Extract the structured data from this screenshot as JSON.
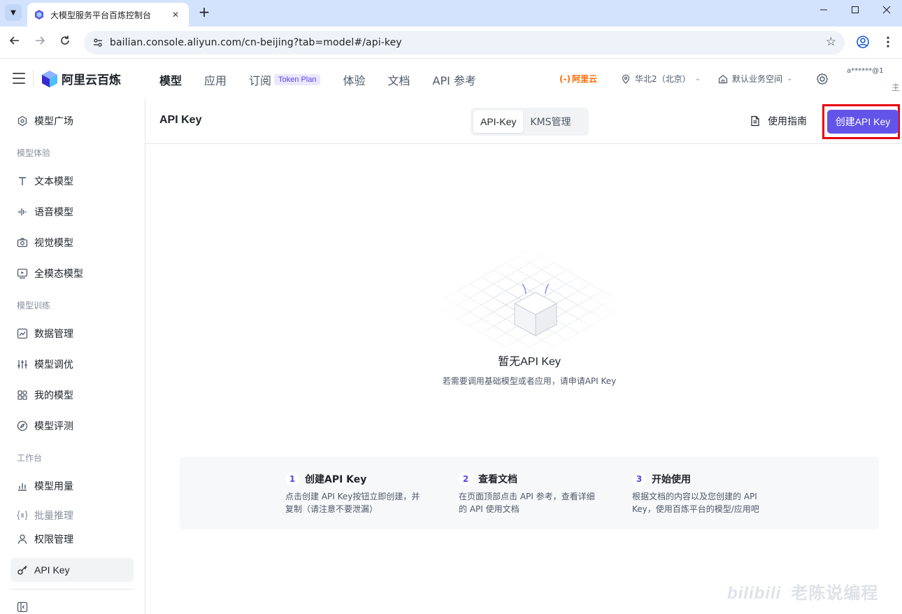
{
  "browser": {
    "tab_title": "大模型服务平台百炼控制台",
    "tab_close": "✕",
    "new_tab": "+",
    "url": "bailian.console.aliyun.com/cn-beijing?tab=model#/api-key"
  },
  "header": {
    "brand": "阿里云百炼",
    "nav": [
      {
        "label": "模型"
      },
      {
        "label": "应用"
      },
      {
        "label": "订阅"
      },
      {
        "label": "体验"
      },
      {
        "label": "文档"
      },
      {
        "label": "API 参考"
      }
    ],
    "token_badge": "Token Plan",
    "aliyun_mark": "(-)",
    "aliyun_label": "阿里云",
    "region": "华北2（北京）",
    "workspace": "默认业务空间",
    "user": "a******@1",
    "user_role": "主"
  },
  "sidebar": {
    "items": [
      {
        "label": "模型广场"
      },
      {
        "label": "文本模型"
      },
      {
        "label": "语音模型"
      },
      {
        "label": "视觉模型"
      },
      {
        "label": "全模态模型"
      },
      {
        "label": "数据管理"
      },
      {
        "label": "模型调优"
      },
      {
        "label": "我的模型"
      },
      {
        "label": "模型评测"
      },
      {
        "label": "模型用量"
      },
      {
        "label": "批量推理"
      },
      {
        "label": "权限管理"
      },
      {
        "label": "API Key"
      }
    ],
    "groups": [
      "模型体验",
      "模型训练",
      "工作台"
    ]
  },
  "page": {
    "title": "API Key",
    "tabs": [
      {
        "label": "API-Key"
      },
      {
        "label": "KMS管理"
      }
    ],
    "guide_label": "使用指南",
    "create_label": "创建API Key",
    "empty_title": "暂无API Key",
    "empty_desc": "若需要调用基础模型或者应用，请申请API Key"
  },
  "steps": [
    {
      "num": "1",
      "title": "创建API Key",
      "desc": "点击创建 API Key按钮立即创建，并复制（请注意不要泄漏）"
    },
    {
      "num": "2",
      "title": "查看文档",
      "desc": "在页面顶部点击 API 参考，查看详细的 API 使用文档"
    },
    {
      "num": "3",
      "title": "开始使用",
      "desc": "根据文档的内容以及您创建的 API Key，使用百炼平台的模型/应用吧"
    }
  ],
  "watermark": {
    "logo": "bilibili",
    "text": "老陈说编程"
  },
  "colors": {
    "accent": "#6254e8",
    "highlight": "#e6000f",
    "aliyun": "#ff6a00"
  }
}
